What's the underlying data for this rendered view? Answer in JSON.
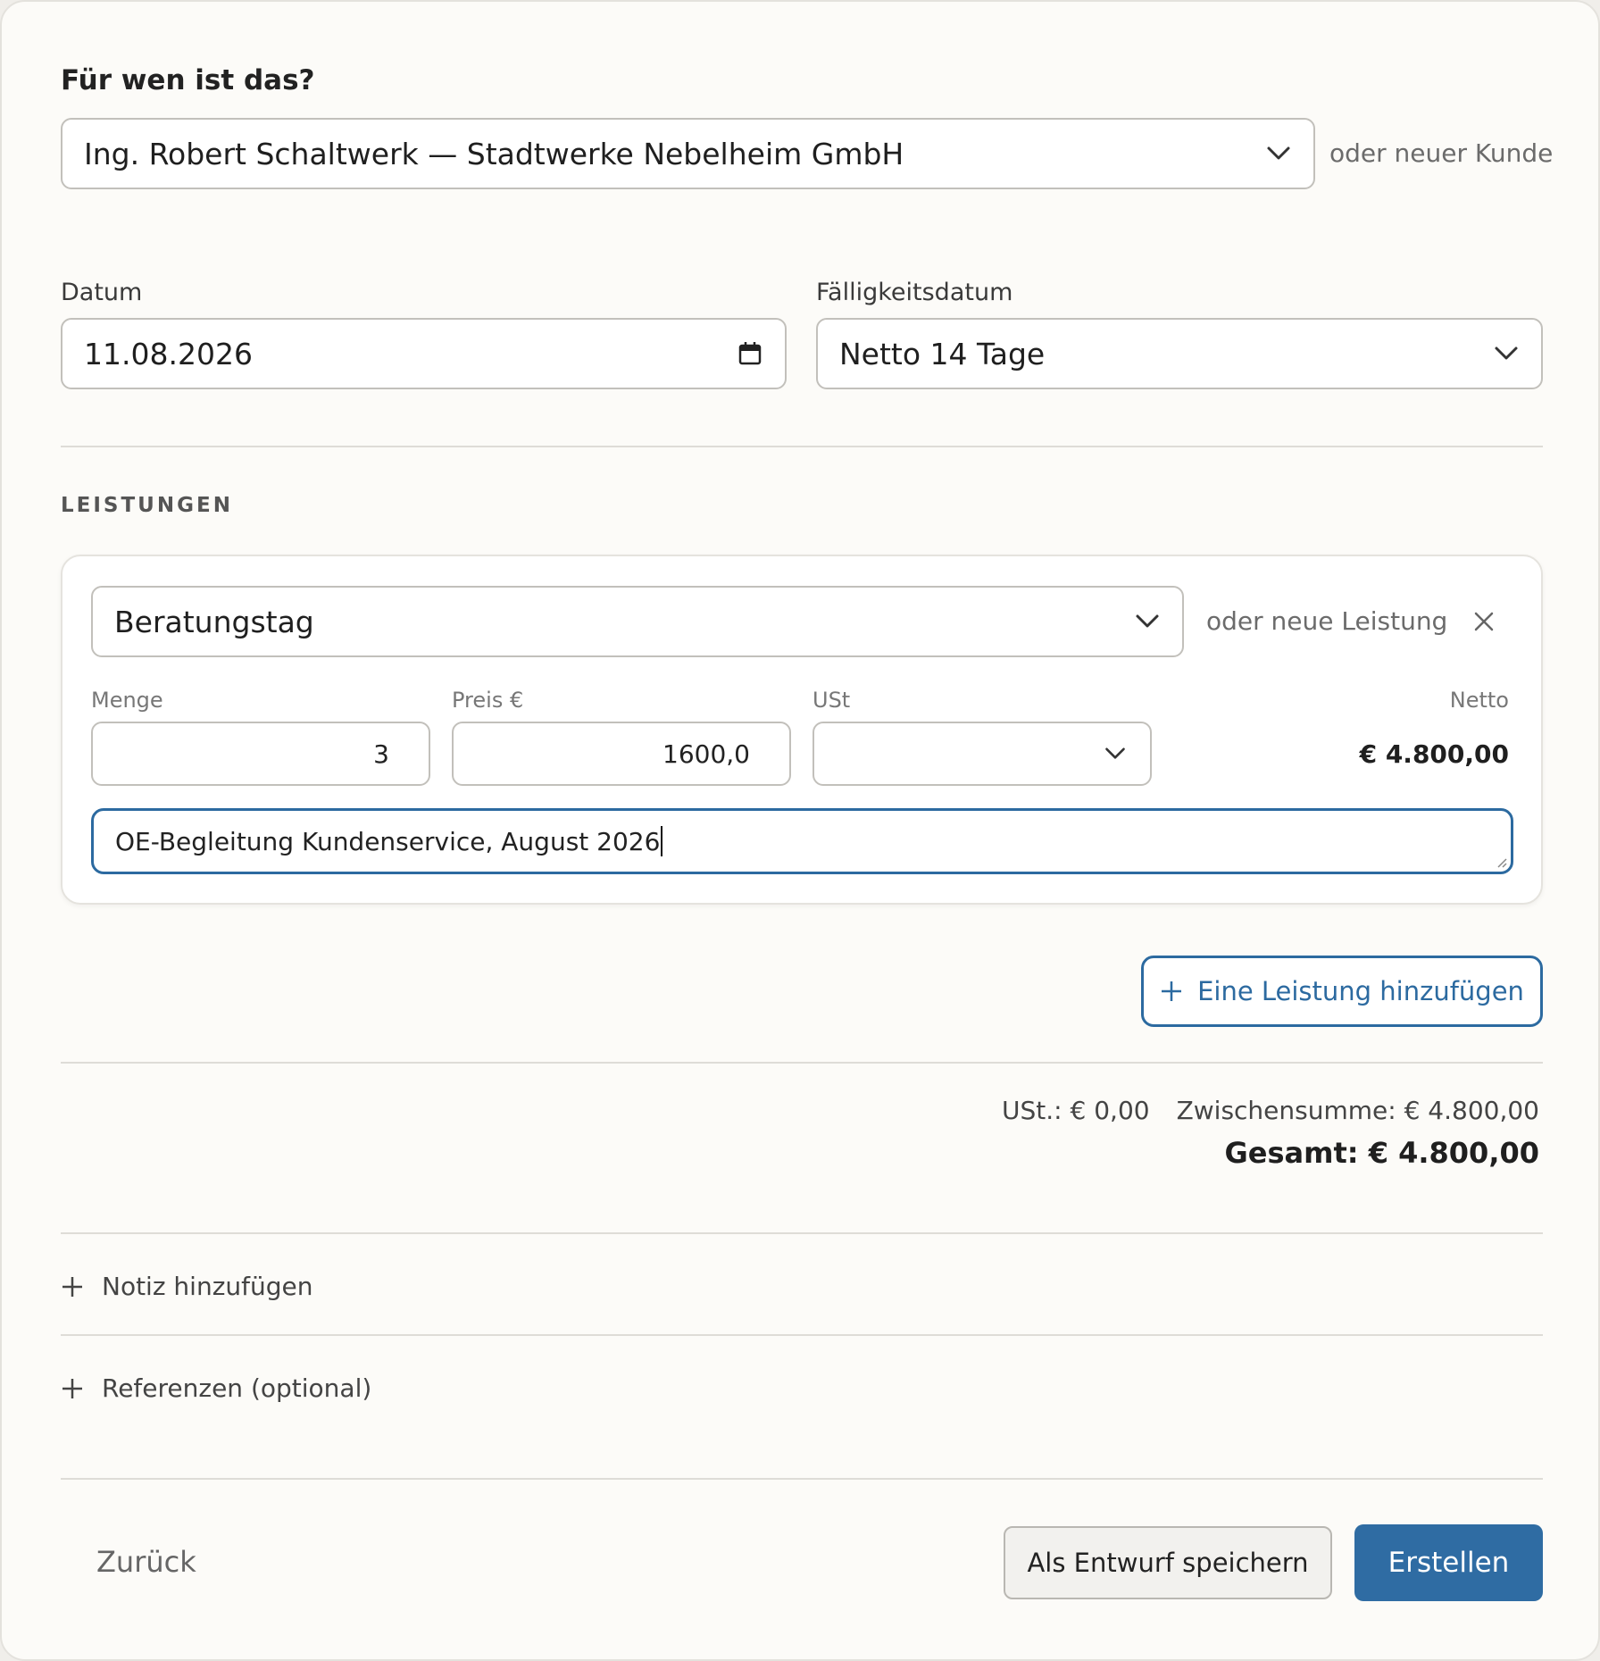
{
  "form": {
    "heading": "Für wen ist das?",
    "customer": {
      "selected": "Ing. Robert Schaltwerk — Stadtwerke Nebelheim GmbH",
      "new_link": "oder neuer Kunde"
    },
    "date": {
      "label": "Datum",
      "value": "11.08.2026"
    },
    "due": {
      "label": "Fälligkeitsdatum",
      "value": "Netto 14 Tage"
    }
  },
  "services": {
    "section_title": "LEISTUNGEN",
    "items": [
      {
        "service": "Beratungstag",
        "new_link": "oder neue Leistung",
        "quantity_label": "Menge",
        "quantity": "3",
        "price_label": "Preis €",
        "price": "1600,0",
        "vat_label": "USt",
        "vat": "",
        "net_label": "Netto",
        "net": "€ 4.800,00",
        "description": "OE-Begleitung Kundenservice, August 2026"
      }
    ],
    "add_label": "Eine Leistung hinzufügen"
  },
  "totals": {
    "vat": "USt.: € 0,00",
    "subtotal": "Zwischensumme: € 4.800,00",
    "total": "Gesamt: € 4.800,00"
  },
  "extras": {
    "note": "Notiz hinzufügen",
    "references": "Referenzen (optional)"
  },
  "footer": {
    "back": "Zurück",
    "draft": "Als Entwurf speichern",
    "create": "Erstellen"
  },
  "colors": {
    "accent": "#2f6ca3",
    "background": "#fcfbf8"
  }
}
